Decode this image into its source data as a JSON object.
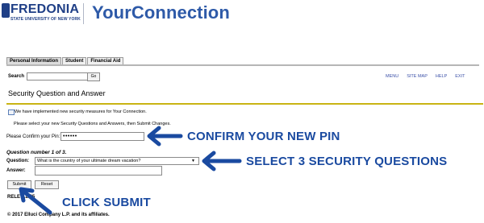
{
  "header": {
    "logo_name": "FREDONIA",
    "logo_subtitle": "STATE UNIVERSITY OF NEW YORK",
    "app_title": "YourConnection"
  },
  "tabs": [
    {
      "label": "Personal Information",
      "active": true
    },
    {
      "label": "Student",
      "active": false
    },
    {
      "label": "Financial Aid",
      "active": false
    }
  ],
  "search": {
    "label": "Search",
    "value": "",
    "go_label": "Go"
  },
  "nav_links": [
    "MENU",
    "SITE MAP",
    "HELP",
    "EXIT"
  ],
  "page_title": "Security Question and Answer",
  "info_message": "We have implemented new security measures for Your Connection.",
  "instructions": "Please select your new Security Questions and Answers, then Submit Changes.",
  "pin": {
    "label": "Please Confirm your Pin:",
    "value": "••••••"
  },
  "question": {
    "number_text": "Question number 1 of 3.",
    "question_label": "Question:",
    "selected_question": "What is the country of your ultimate dream vacation?",
    "answer_label": "Answer:",
    "answer_value": ""
  },
  "buttons": {
    "submit": "Submit",
    "reset": "Reset"
  },
  "release_text": "RELE      8.8.25",
  "copyright": "© 2017 Elluci     Company L.P. and its affiliates.",
  "annotations": {
    "pin": "CONFIRM YOUR NEW PIN",
    "questions": "SELECT 3 SECURITY QUESTIONS",
    "submit": "CLICK SUBMIT"
  },
  "colors": {
    "brand_blue": "#1f3f86",
    "title_blue": "#2e5aa8",
    "annotation_blue": "#1a4aa0",
    "gold_rule": "#c9b414",
    "link_blue": "#3b50a8"
  }
}
